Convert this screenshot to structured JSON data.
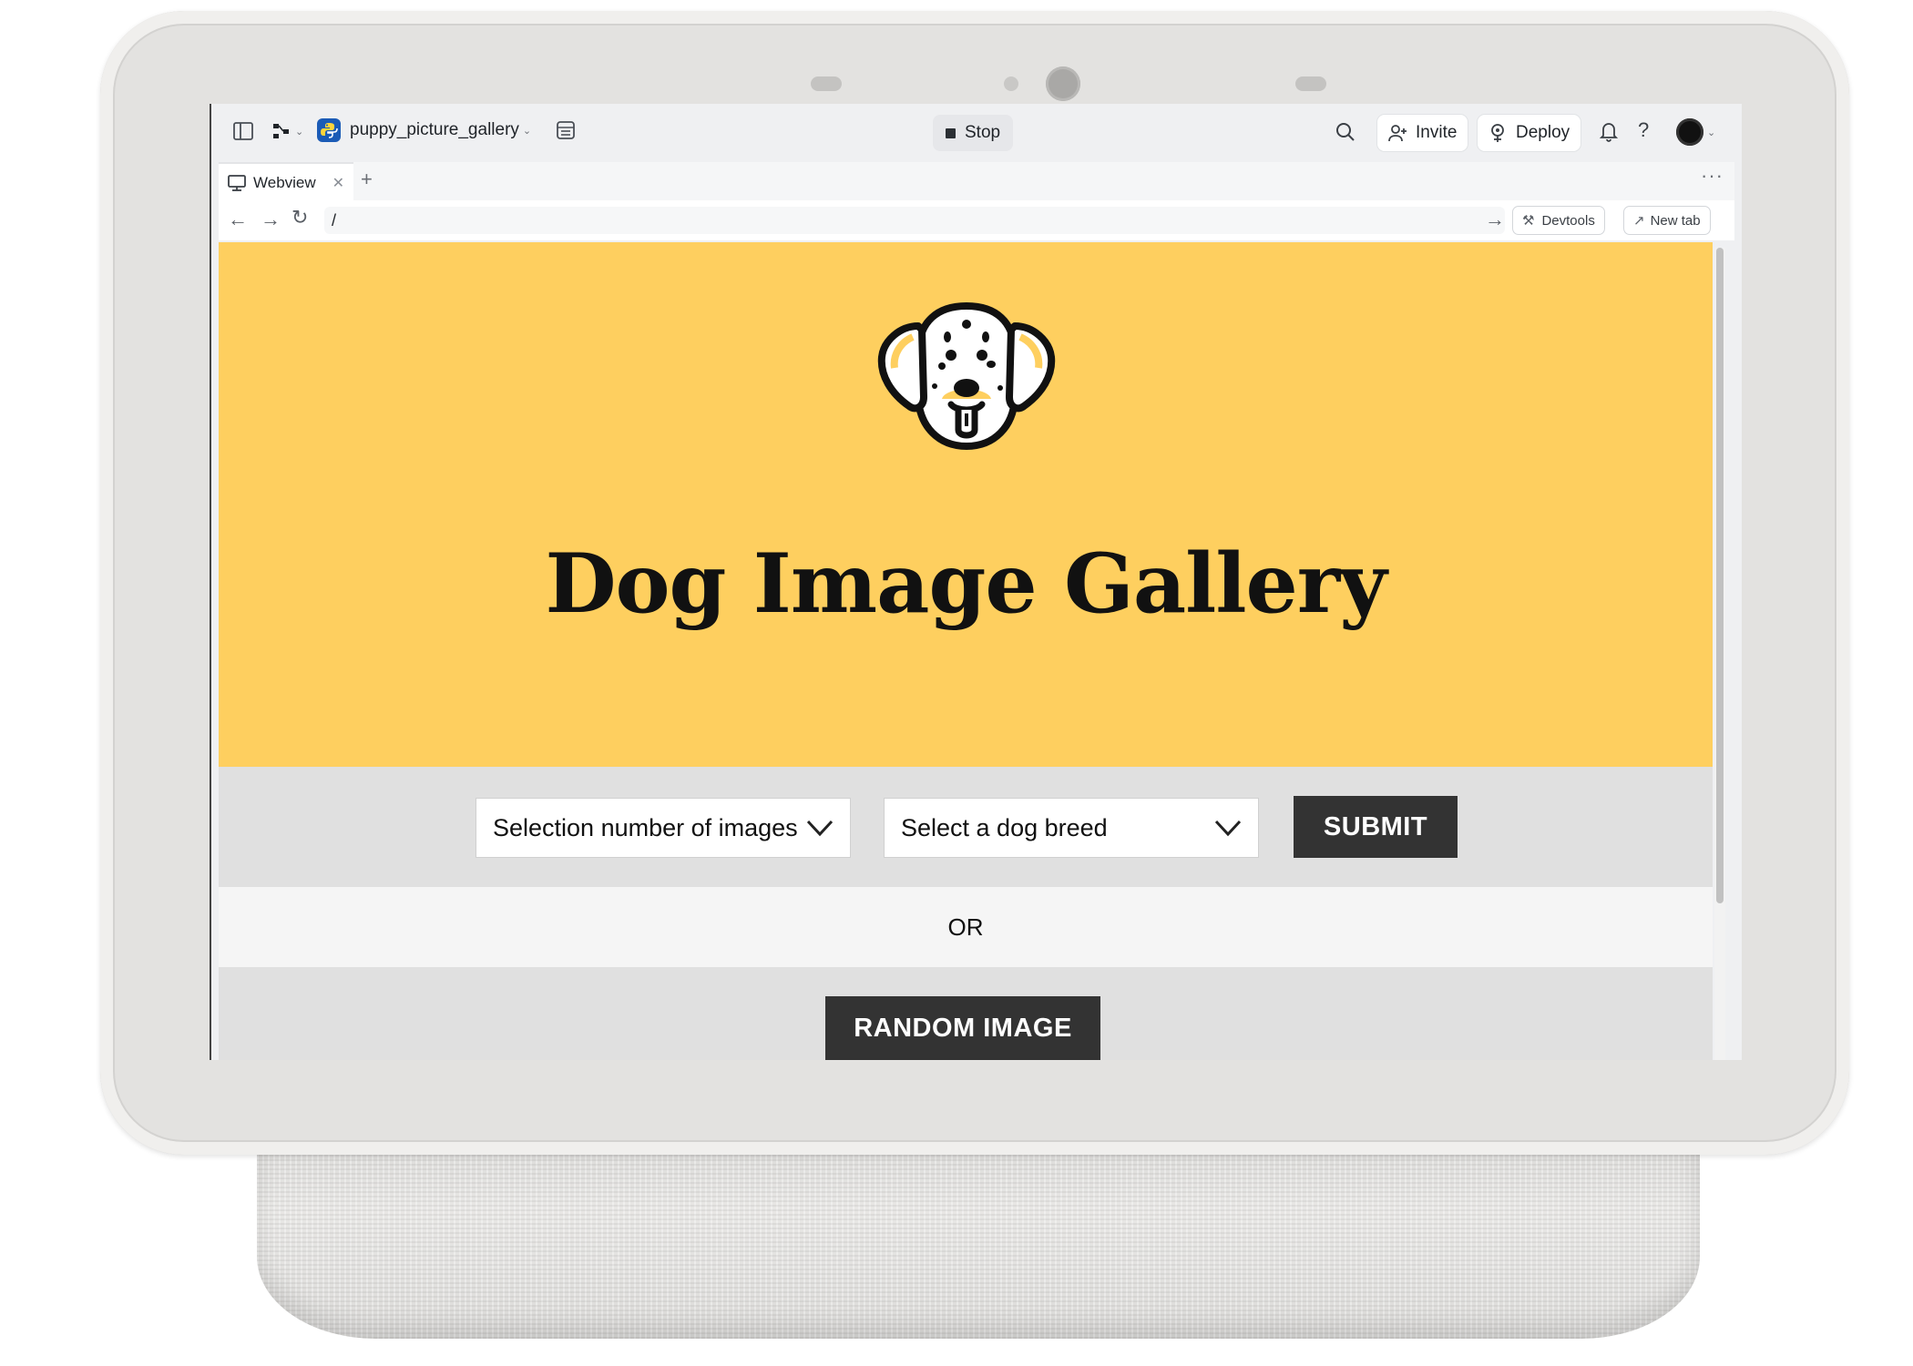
{
  "topbar": {
    "repl_name": "puppy_picture_gallery",
    "stop_label": "Stop",
    "invite_label": "Invite",
    "deploy_label": "Deploy"
  },
  "tabs": [
    {
      "label": "Webview"
    }
  ],
  "urlbar": {
    "value": "/",
    "devtools_label": "Devtools",
    "newtab_label": "New tab"
  },
  "page": {
    "title": "Dog Image Gallery",
    "number_select": "Selection number of images",
    "breed_select": "Select a dog breed",
    "submit_label": "SUBMIT",
    "or_text": "OR",
    "random_label": "RANDOM IMAGE"
  },
  "colors": {
    "hero_bg": "#fecf5f",
    "button_bg": "#333333",
    "controls_bg": "#e0e0e0"
  },
  "icons": [
    "sidebar-toggle-icon",
    "git-branch-icon",
    "python-icon",
    "layout-icon",
    "search-icon",
    "add-user-icon",
    "deploy-icon",
    "bell-icon",
    "help-icon",
    "avatar",
    "monitor-icon",
    "dalmatian-logo"
  ]
}
